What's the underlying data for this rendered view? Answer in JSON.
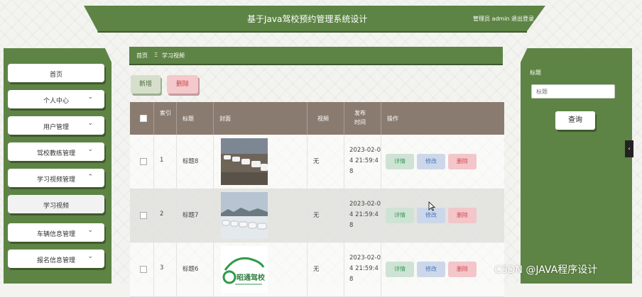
{
  "header": {
    "title": "基于Java驾校预约管理系统设计",
    "admin_label": "管理员 admin",
    "logout_label": "退出登录"
  },
  "sidebar": {
    "items": [
      {
        "label": "首页",
        "has_chevron": false,
        "chevron": ""
      },
      {
        "label": "个人中心",
        "has_chevron": true,
        "chevron": "chevron-down"
      },
      {
        "label": "用户管理",
        "has_chevron": true,
        "chevron": "chevron-down"
      },
      {
        "label": "驾校教练管理",
        "has_chevron": true,
        "chevron": "chevron-down"
      },
      {
        "label": "学习视频管理",
        "has_chevron": true,
        "chevron": "chevron-up"
      },
      {
        "label": "学习视频",
        "has_chevron": false,
        "chevron": "",
        "active": true
      },
      {
        "label": "车辆信息管理",
        "has_chevron": true,
        "chevron": "chevron-down"
      },
      {
        "label": "报名信息管理",
        "has_chevron": true,
        "chevron": "chevron-down"
      }
    ]
  },
  "breadcrumb": {
    "home": "首页",
    "separator": "Ξ",
    "current": "学习视频"
  },
  "toolbar": {
    "add_label": "新增",
    "delete_label": "删除"
  },
  "table": {
    "headers": {
      "index": "索引",
      "title": "标题",
      "cover": "封面",
      "video": "视频",
      "publish_time": "发布时间",
      "actions": "操作"
    },
    "rows": [
      {
        "index": "1",
        "title": "标题8",
        "cover": "parking-lot-cars",
        "video": "无",
        "time": "2023-02-04 21:59:48"
      },
      {
        "index": "2",
        "title": "标题7",
        "cover": "snowy-cars",
        "video": "无",
        "time": "2023-02-04 21:59:48"
      },
      {
        "index": "3",
        "title": "标题6",
        "cover": "driving-school-logo",
        "logo_text": "昭通驾校",
        "video": "无",
        "time": "2023-02-04 21:59:48"
      }
    ],
    "action_labels": {
      "detail": "详情",
      "edit": "修改",
      "delete": "删除"
    }
  },
  "search_panel": {
    "label": "标题",
    "placeholder": "标题",
    "button_label": "查询"
  },
  "side_tab": {
    "icon": "chevron-left"
  },
  "watermark": "CSDN @JAVA程序设计",
  "colors": {
    "primary_green": "#5d8444",
    "table_header": "#8a7b70",
    "danger": "#d34a55",
    "info": "#4a76b8",
    "success": "#3c9b5c"
  }
}
